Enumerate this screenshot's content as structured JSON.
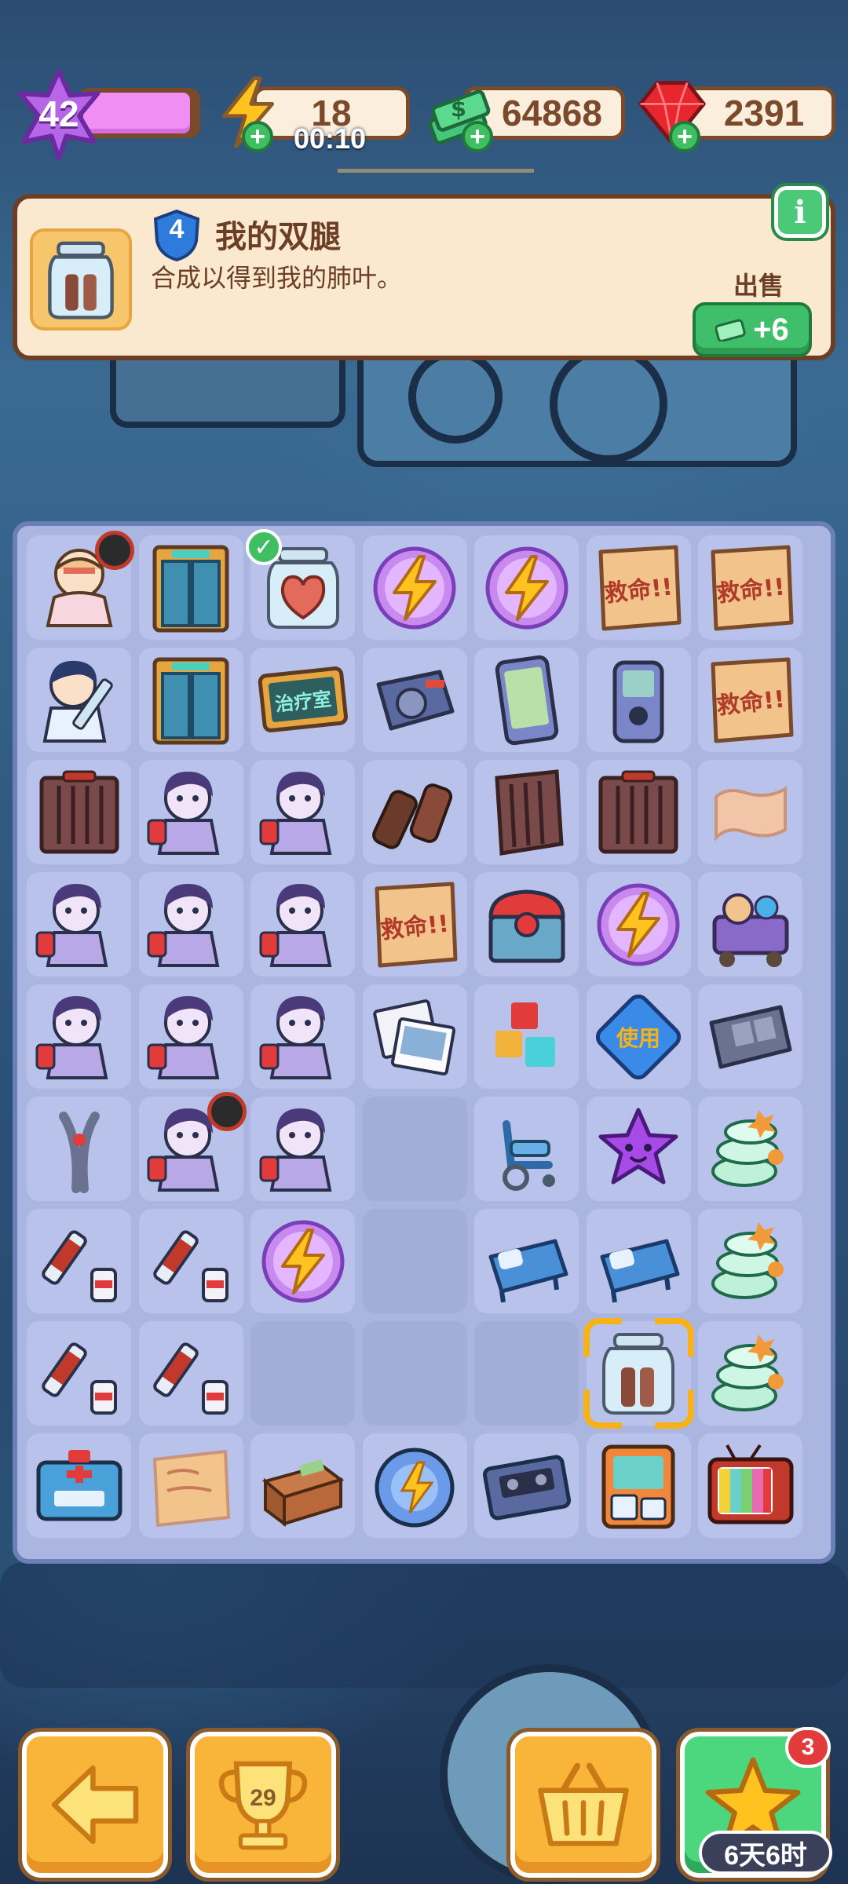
{
  "hud": {
    "level": "42",
    "energy": "18",
    "energy_timer": "00:10",
    "cash": "64868",
    "gems": "2391",
    "level_progress": 0.95
  },
  "info_panel": {
    "item_level": "4",
    "title": "我的双腿",
    "description": "合成以得到我的肺叶。",
    "sell_label": "出售",
    "sell_value": "+6"
  },
  "board": {
    "cols": 7,
    "rows": 9,
    "cells": [
      [
        "girl-bandaged",
        "elevator",
        "jar-heart",
        "energy-orb",
        "energy-orb",
        "help-note",
        "help-note"
      ],
      [
        "girl-syringe",
        "elevator",
        "sign-treatment",
        "radio",
        "phone",
        "walkie-talkie",
        "help-note"
      ],
      [
        "cage",
        "nurse",
        "nurse",
        "binocular",
        "cage-open",
        "cage",
        "paper-scroll"
      ],
      [
        "nurse",
        "nurse",
        "nurse",
        "help-note",
        "treasure-chest",
        "energy-orb",
        "toy-cart"
      ],
      [
        "nurse",
        "nurse",
        "nurse",
        "photos",
        "blocks",
        "use-ticket",
        "film-strip"
      ],
      [
        "pliers",
        "nurse",
        "nurse",
        "empty",
        "wheelchair",
        "purple-star",
        "pills-stack"
      ],
      [
        "syringe-vial",
        "syringe-vial",
        "energy-orb",
        "empty",
        "hospital-bed",
        "hospital-bed",
        "pills-stack"
      ],
      [
        "syringe-vial",
        "syringe-vial",
        "empty",
        "empty",
        "empty",
        "jar-legs",
        "pills-stack"
      ],
      [
        "ambulance",
        "paper-letter",
        "cardboard-box",
        "energy-disc",
        "cassette",
        "arcade-machine",
        "tv"
      ]
    ],
    "labels": {
      "help_note": "救命!!",
      "treatment_sign": "治疗室",
      "use_ticket": "使用"
    },
    "selected": "jar-legs"
  },
  "bottom": {
    "trophy_count": "29",
    "event_badge": "3",
    "event_time": "6天6时"
  }
}
